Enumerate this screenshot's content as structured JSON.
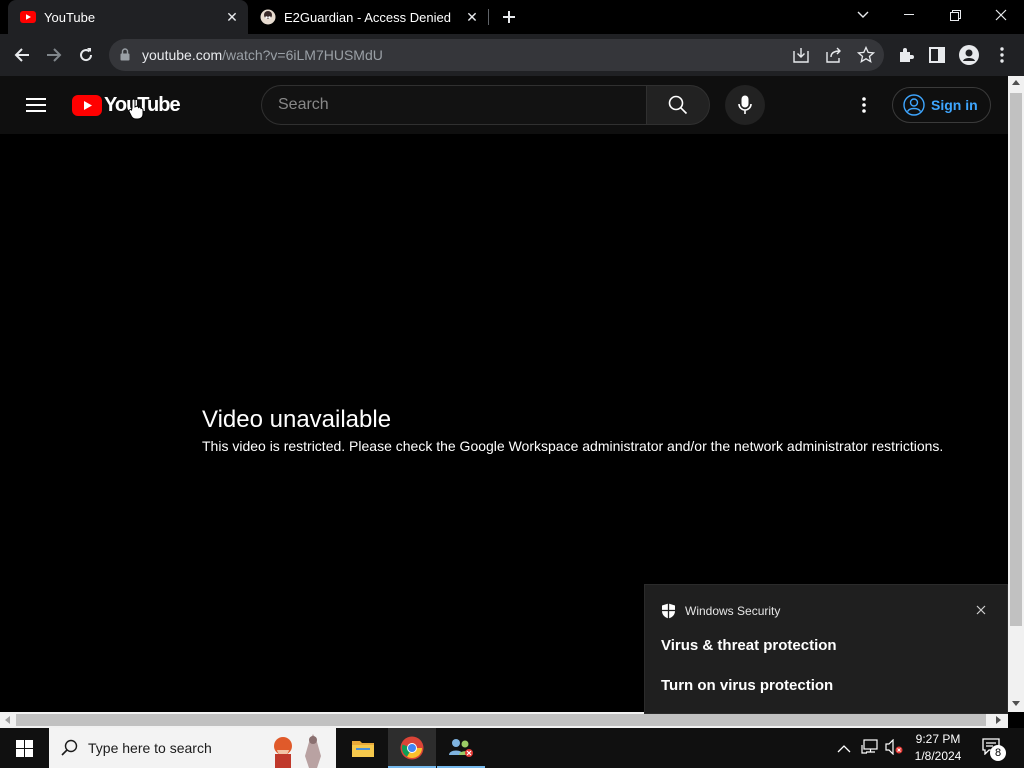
{
  "colors": {
    "yt_red": "#ff0000",
    "link_blue": "#3ea6ff",
    "omnibox_bg": "#35363a",
    "toolbar_bg": "#202124"
  },
  "browser": {
    "tabs": [
      {
        "title": "YouTube",
        "icon": "youtube-icon",
        "active": true
      },
      {
        "title": "E2Guardian - Access Denied",
        "icon": "e2guardian-icon",
        "active": false
      }
    ],
    "url_host": "youtube.com",
    "url_path": "/watch?v=6iLM7HUSMdU"
  },
  "youtube": {
    "logo_text": "YouTube",
    "search_placeholder": "Search",
    "signin_label": "Sign in",
    "error_title": "Video unavailable",
    "error_message": "This video is restricted. Please check the Google Workspace administrator and/or the network administrator restrictions."
  },
  "toast": {
    "app": "Windows Security",
    "title": "Virus & threat protection",
    "body": "Turn on virus protection"
  },
  "taskbar": {
    "search_placeholder": "Type here to search",
    "time": "9:27 PM",
    "date": "1/8/2024",
    "notification_count": "8"
  }
}
